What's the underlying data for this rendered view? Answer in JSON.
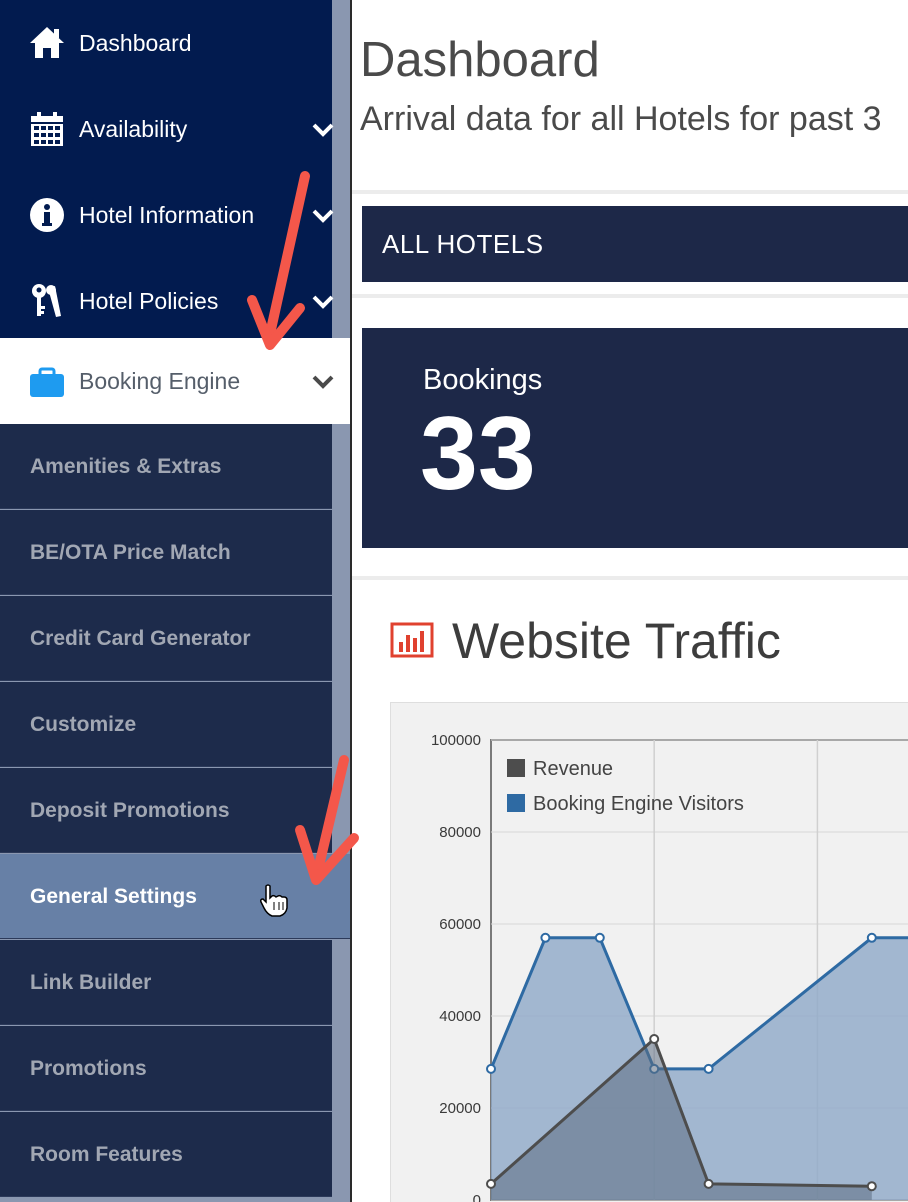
{
  "sidebar": {
    "nav_items": [
      {
        "label": "Dashboard",
        "icon": "home-icon",
        "has_chevron": false
      },
      {
        "label": "Availability",
        "icon": "calendar-icon",
        "has_chevron": true
      },
      {
        "label": "Hotel Information",
        "icon": "info-icon",
        "has_chevron": true
      },
      {
        "label": "Hotel Policies",
        "icon": "keys-icon",
        "has_chevron": true
      },
      {
        "label": "Booking Engine",
        "icon": "briefcase-icon",
        "has_chevron": true,
        "active": true
      }
    ],
    "sub_items": [
      {
        "label": "Amenities & Extras"
      },
      {
        "label": "BE/OTA Price Match"
      },
      {
        "label": "Credit Card Generator"
      },
      {
        "label": "Customize"
      },
      {
        "label": "Deposit Promotions"
      },
      {
        "label": "General Settings",
        "selected": true
      },
      {
        "label": "Link Builder"
      },
      {
        "label": "Promotions"
      },
      {
        "label": "Room Features"
      }
    ]
  },
  "main": {
    "title": "Dashboard",
    "subtitle": "Arrival data for all Hotels for past 3",
    "hotel_selector": {
      "label": "ALL HOTELS"
    },
    "bookings": {
      "label": "Bookings",
      "value": "33"
    },
    "traffic": {
      "title": "Website Traffic",
      "icon": "bar-chart-icon"
    }
  },
  "chart_data": {
    "type": "area",
    "title": "Website Traffic",
    "ylim": [
      0,
      100000
    ],
    "y_ticks": [
      "100000",
      "80000",
      "60000",
      "40000",
      "20000",
      "0"
    ],
    "grid": true,
    "legend": "top-left",
    "series": [
      {
        "name": "Revenue",
        "color": "#4d4d4d",
        "values": [
          3500,
          null,
          null,
          35000,
          3500,
          null,
          null,
          3000
        ]
      },
      {
        "name": "Booking Engine Visitors",
        "color": "#2e6aa3",
        "values": [
          28500,
          57000,
          57000,
          28500,
          28500,
          null,
          null,
          57000,
          57000
        ]
      }
    ]
  },
  "colors": {
    "sidebar_bg": "#021b4f",
    "submenu_bg": "#1d2b4b",
    "selected_bg": "#6780a6",
    "card_bg": "#1d2848",
    "arrow": "#f4574a",
    "brand_blue": "#1e9bf0"
  }
}
